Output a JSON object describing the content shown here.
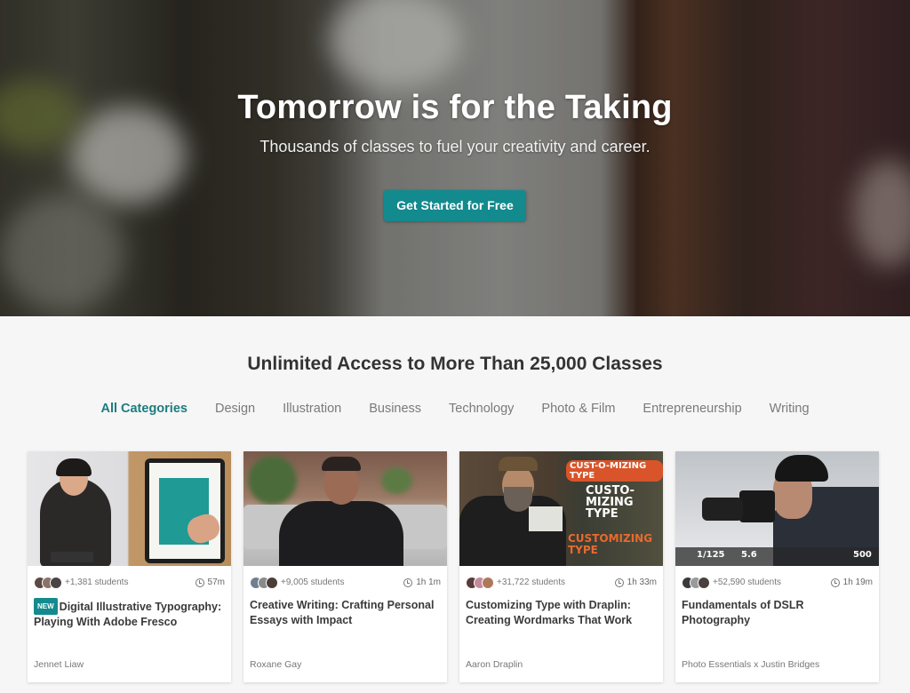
{
  "hero": {
    "title": "Tomorrow is for the Taking",
    "subtitle": "Thousands of classes to fuel your creativity and career.",
    "cta_label": "Get Started for Free",
    "accent": "#138a8e"
  },
  "section": {
    "title": "Unlimited Access to More Than 25,000 Classes",
    "categories": [
      {
        "label": "All Categories",
        "active": true
      },
      {
        "label": "Design",
        "active": false
      },
      {
        "label": "Illustration",
        "active": false
      },
      {
        "label": "Business",
        "active": false
      },
      {
        "label": "Technology",
        "active": false
      },
      {
        "label": "Photo & Film",
        "active": false
      },
      {
        "label": "Entrepreneurship",
        "active": false
      },
      {
        "label": "Writing",
        "active": false
      }
    ]
  },
  "cards": [
    {
      "students": "+1,381 students",
      "duration": "57m",
      "badge": "NEW",
      "title": "Digital Illustrative Typography: Playing With Adobe Fresco",
      "author": "Jennet Liaw",
      "thumb_icon": "tablet-drawing-image"
    },
    {
      "students": "+9,005 students",
      "duration": "1h 1m",
      "badge": "",
      "title": "Creative Writing: Crafting Personal Essays with Impact",
      "author": "Roxane Gay",
      "thumb_icon": "instructor-portrait-image"
    },
    {
      "students": "+31,722 students",
      "duration": "1h 33m",
      "badge": "",
      "title": "Customizing Type with Draplin: Creating Wordmarks That Work",
      "author": "Aaron Draplin",
      "thumb_icon": "custom-type-image",
      "thumb_text": [
        "CUST-O-MIZING TYPE",
        "CUSTO-MIZING TYPE",
        "CUSTOMIZING TYPE"
      ]
    },
    {
      "students": "+52,590 students",
      "duration": "1h 19m",
      "badge": "",
      "title": "Fundamentals of DSLR Photography",
      "author": "Photo Essentials x Justin Bridges",
      "thumb_icon": "camera-photographer-image",
      "thumb_text": [
        "1/125",
        "5.6",
        "500"
      ]
    }
  ]
}
